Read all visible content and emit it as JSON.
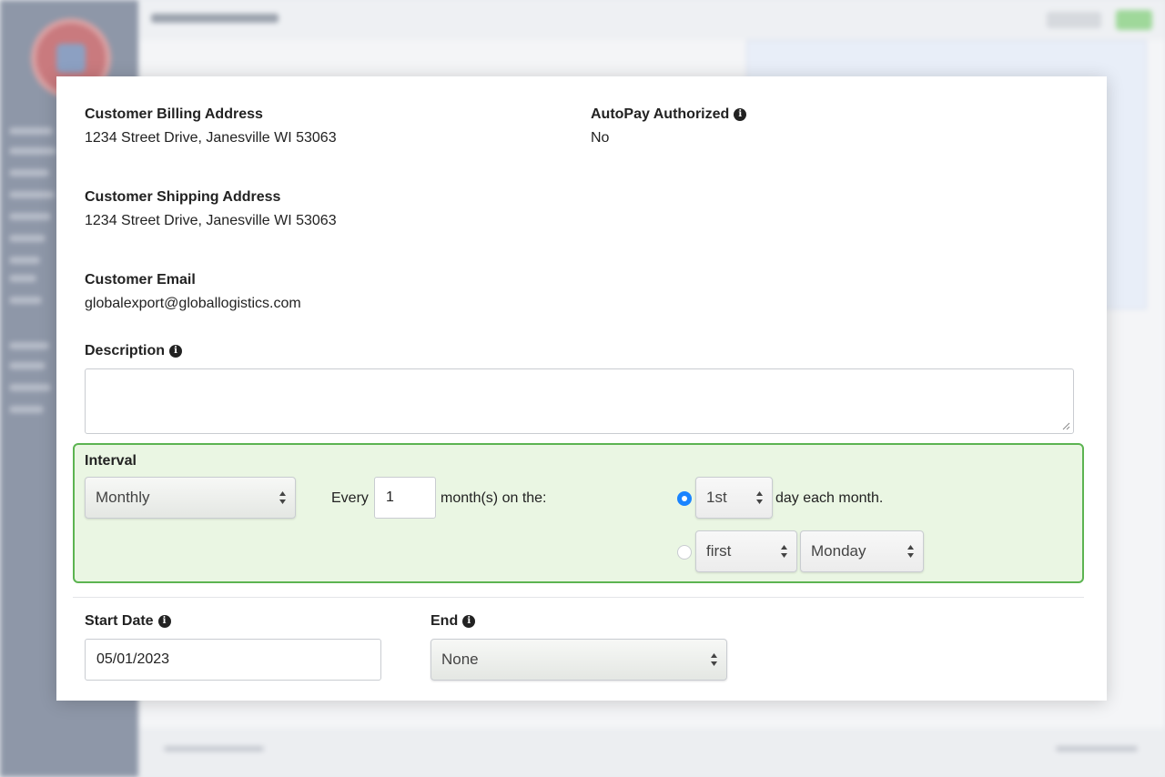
{
  "billing": {
    "label": "Customer Billing Address",
    "value": "1234 Street Drive, Janesville WI 53063"
  },
  "autopay": {
    "label": "AutoPay Authorized",
    "value": "No"
  },
  "shipping": {
    "label": "Customer Shipping Address",
    "value": "1234 Street Drive, Janesville WI 53063"
  },
  "email": {
    "label": "Customer Email",
    "value": "globalexport@globallogistics.com"
  },
  "description": {
    "label": "Description",
    "value": ""
  },
  "interval": {
    "label": "Interval",
    "frequency": "Monthly",
    "every_label": "Every",
    "every_value": "1",
    "unit_label": "month(s) on the:",
    "option1": {
      "day": "1st",
      "suffix": "day each month.",
      "selected": true
    },
    "option2": {
      "ordinal": "first",
      "weekday": "Monday",
      "selected": false
    }
  },
  "start_date": {
    "label": "Start Date",
    "value": "05/01/2023"
  },
  "end": {
    "label": "End",
    "value": "None"
  },
  "colors": {
    "accent": "#5cb451",
    "interval_bg": "#eaf6e3",
    "radio": "#1a84ff"
  }
}
